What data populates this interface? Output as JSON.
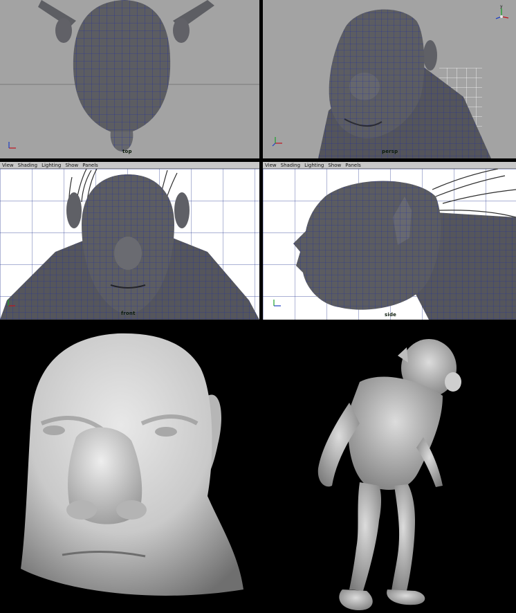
{
  "viewports": {
    "top": {
      "camera_label": "top"
    },
    "persp": {
      "camera_label": "persp"
    },
    "front": {
      "camera_label": "front",
      "menu": [
        "View",
        "Shading",
        "Lighting",
        "Show",
        "Panels"
      ]
    },
    "side": {
      "camera_label": "side",
      "menu": [
        "View",
        "Shading",
        "Lighting",
        "Show",
        "Panels"
      ]
    }
  },
  "axis_labels": {
    "x": "x",
    "y": "y",
    "z": "z"
  },
  "colors": {
    "viewport_bg": "#a3a3a3",
    "wire": "#1f2ea0",
    "mesh": "#595a60",
    "render_bg": "#000000",
    "active_border": "#1c2f7a"
  }
}
